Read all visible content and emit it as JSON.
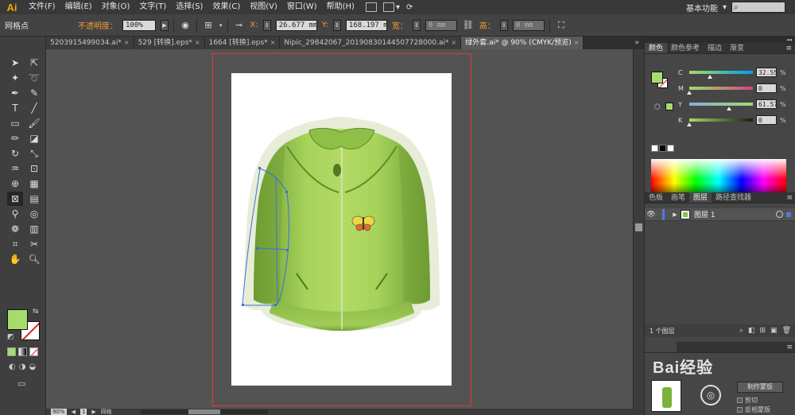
{
  "app": {
    "logo": "Ai"
  },
  "menu": {
    "items": [
      "文件(F)",
      "编辑(E)",
      "对象(O)",
      "文字(T)",
      "选择(S)",
      "效果(C)",
      "视图(V)",
      "窗口(W)",
      "帮助(H)"
    ],
    "workspace": "基本功能",
    "search_placeholder": ""
  },
  "control_bar": {
    "selection_label": "网格点",
    "opacity_label": "不透明度：",
    "opacity_value": "100%",
    "x_label": "X:",
    "x_value": "26.677 mm",
    "y_label": "Y:",
    "y_value": "168.197 m",
    "w_label": "宽：",
    "w_value": "0 mm",
    "h_label": "高：",
    "h_value": "0 mm"
  },
  "tabs": [
    {
      "label": "5203915499034.ai*",
      "active": false
    },
    {
      "label": "529 [转换].eps*",
      "active": false
    },
    {
      "label": "1664 [转换].eps*",
      "active": false
    },
    {
      "label": "Nipic_29842067_20190830144507728000.ai*",
      "active": false
    },
    {
      "label": "绿外套.ai* @ 90% (CMYK/预览)",
      "active": true
    }
  ],
  "tabs_more": "»",
  "tools": [
    "selection-tool",
    "direct-selection-tool",
    "magic-wand-tool",
    "lasso-tool",
    "pen-tool",
    "curvature-tool",
    "type-tool",
    "line-segment-tool",
    "rectangle-tool",
    "paintbrush-tool",
    "pencil-tool",
    "eraser-tool",
    "rotate-tool",
    "scale-tool",
    "warp-tool",
    "free-transform-tool",
    "shape-builder-tool",
    "perspective-grid-tool",
    "mesh-tool",
    "gradient-tool",
    "eyedropper-tool",
    "blend-tool",
    "symbol-sprayer-tool",
    "column-graph-tool",
    "artboard-tool",
    "slice-tool",
    "hand-tool",
    "zoom-tool"
  ],
  "colors": {
    "fill": "#a6dc6e",
    "jacket_light": "#a6d35a",
    "jacket_dark": "#5e8c2a",
    "halo": "#e7edd8",
    "artboard": "#ffffff",
    "bleed": "#e23a32",
    "selection": "#3d6fd9"
  },
  "status_bar": {
    "zoom": "90%",
    "page": "1",
    "label": "网格"
  },
  "color_panel": {
    "tabs": [
      "颜色",
      "颜色参考",
      "描边",
      "渐变"
    ],
    "channels": [
      {
        "label": "C",
        "value": "32.55",
        "fraction": 0.33,
        "gradient": "linear-gradient(90deg,#a4d96d,#00a0e9)"
      },
      {
        "label": "M",
        "value": "0",
        "fraction": 0.0,
        "gradient": "linear-gradient(90deg,#a4d96d,#d4437a)"
      },
      {
        "label": "Y",
        "value": "61.57",
        "fraction": 0.62,
        "gradient": "linear-gradient(90deg,#7fb0e0,#a4d96d)"
      },
      {
        "label": "K",
        "value": "0",
        "fraction": 0.0,
        "gradient": "linear-gradient(90deg,#a4d96d,#1a1a1a)"
      }
    ],
    "unit": "%"
  },
  "swatch_tabs": [
    "色板",
    "画笔",
    "图层",
    "路径查找器"
  ],
  "layers": {
    "items": [
      {
        "name": "图层 1"
      }
    ],
    "count_label": "1 个图层"
  },
  "transparency": {
    "mask_button": "制作蒙版",
    "clip_label": "剪切",
    "invert_label": "反相蒙版"
  },
  "watermark": {
    "text": "Bai经验"
  }
}
